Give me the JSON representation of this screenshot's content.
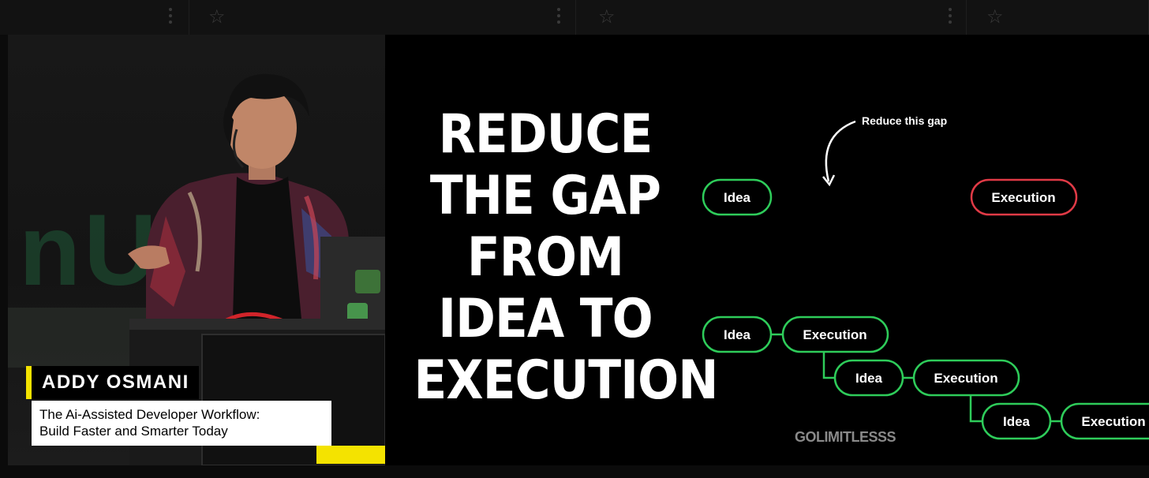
{
  "speaker": {
    "name": "ADDY OSMANI",
    "talk_title_line1": "The Ai-Assisted Developer Workflow:",
    "talk_title_line2": "Build Faster and Smarter Today"
  },
  "stage_backdrop_text": "nU",
  "slide": {
    "title_lines": [
      "REDUCE",
      "THE GAP",
      "FROM",
      "IDEA TO",
      "EXECUTION"
    ],
    "annotation": "Reduce this gap",
    "top_nodes": {
      "idea": "Idea",
      "execution": "Execution"
    },
    "iterations": [
      {
        "idea": "Idea",
        "execution": "Execution"
      },
      {
        "idea": "Idea",
        "execution": "Execution"
      },
      {
        "idea": "Idea",
        "execution": "Execution"
      }
    ],
    "brand": "GOLIMITLESSS"
  },
  "colors": {
    "idea_stroke": "#2ecc5a",
    "execution_stroke": "#e03a46",
    "lower_third_accent": "#f4e300"
  },
  "icons": {
    "star": "star-icon",
    "more": "more-vertical-icon"
  }
}
